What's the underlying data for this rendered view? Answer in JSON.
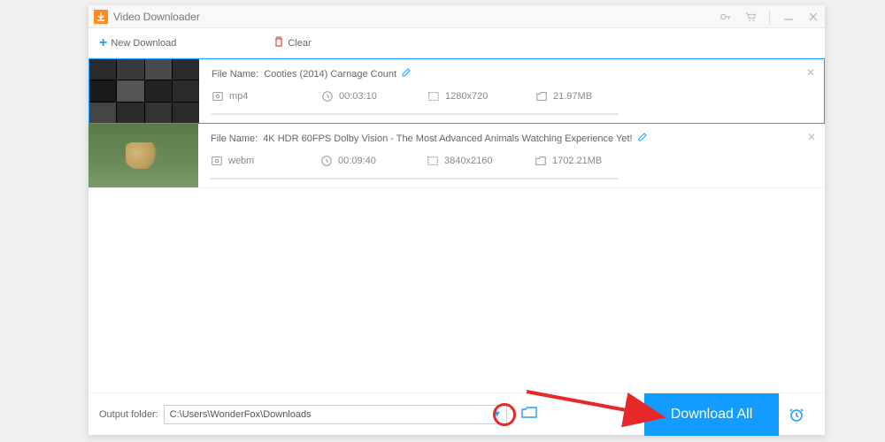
{
  "app": {
    "title": "Video Downloader"
  },
  "actions": {
    "newDownload": "New Download",
    "clear": "Clear"
  },
  "items": [
    {
      "filenameLabel": "File Name:",
      "filename": "Cooties (2014) Carnage Count",
      "format": "mp4",
      "duration": "00:03:10",
      "resolution": "1280x720",
      "size": "21.97MB"
    },
    {
      "filenameLabel": "File Name:",
      "filename": "4K HDR 60FPS Dolby Vision - The Most Advanced Animals Watching Experience Yet!",
      "format": "webm",
      "duration": "00:09:40",
      "resolution": "3840x2160",
      "size": "1702.21MB"
    }
  ],
  "output": {
    "label": "Output folder:",
    "path": "C:\\Users\\WonderFox\\Downloads"
  },
  "buttons": {
    "downloadAll": "Download All"
  }
}
